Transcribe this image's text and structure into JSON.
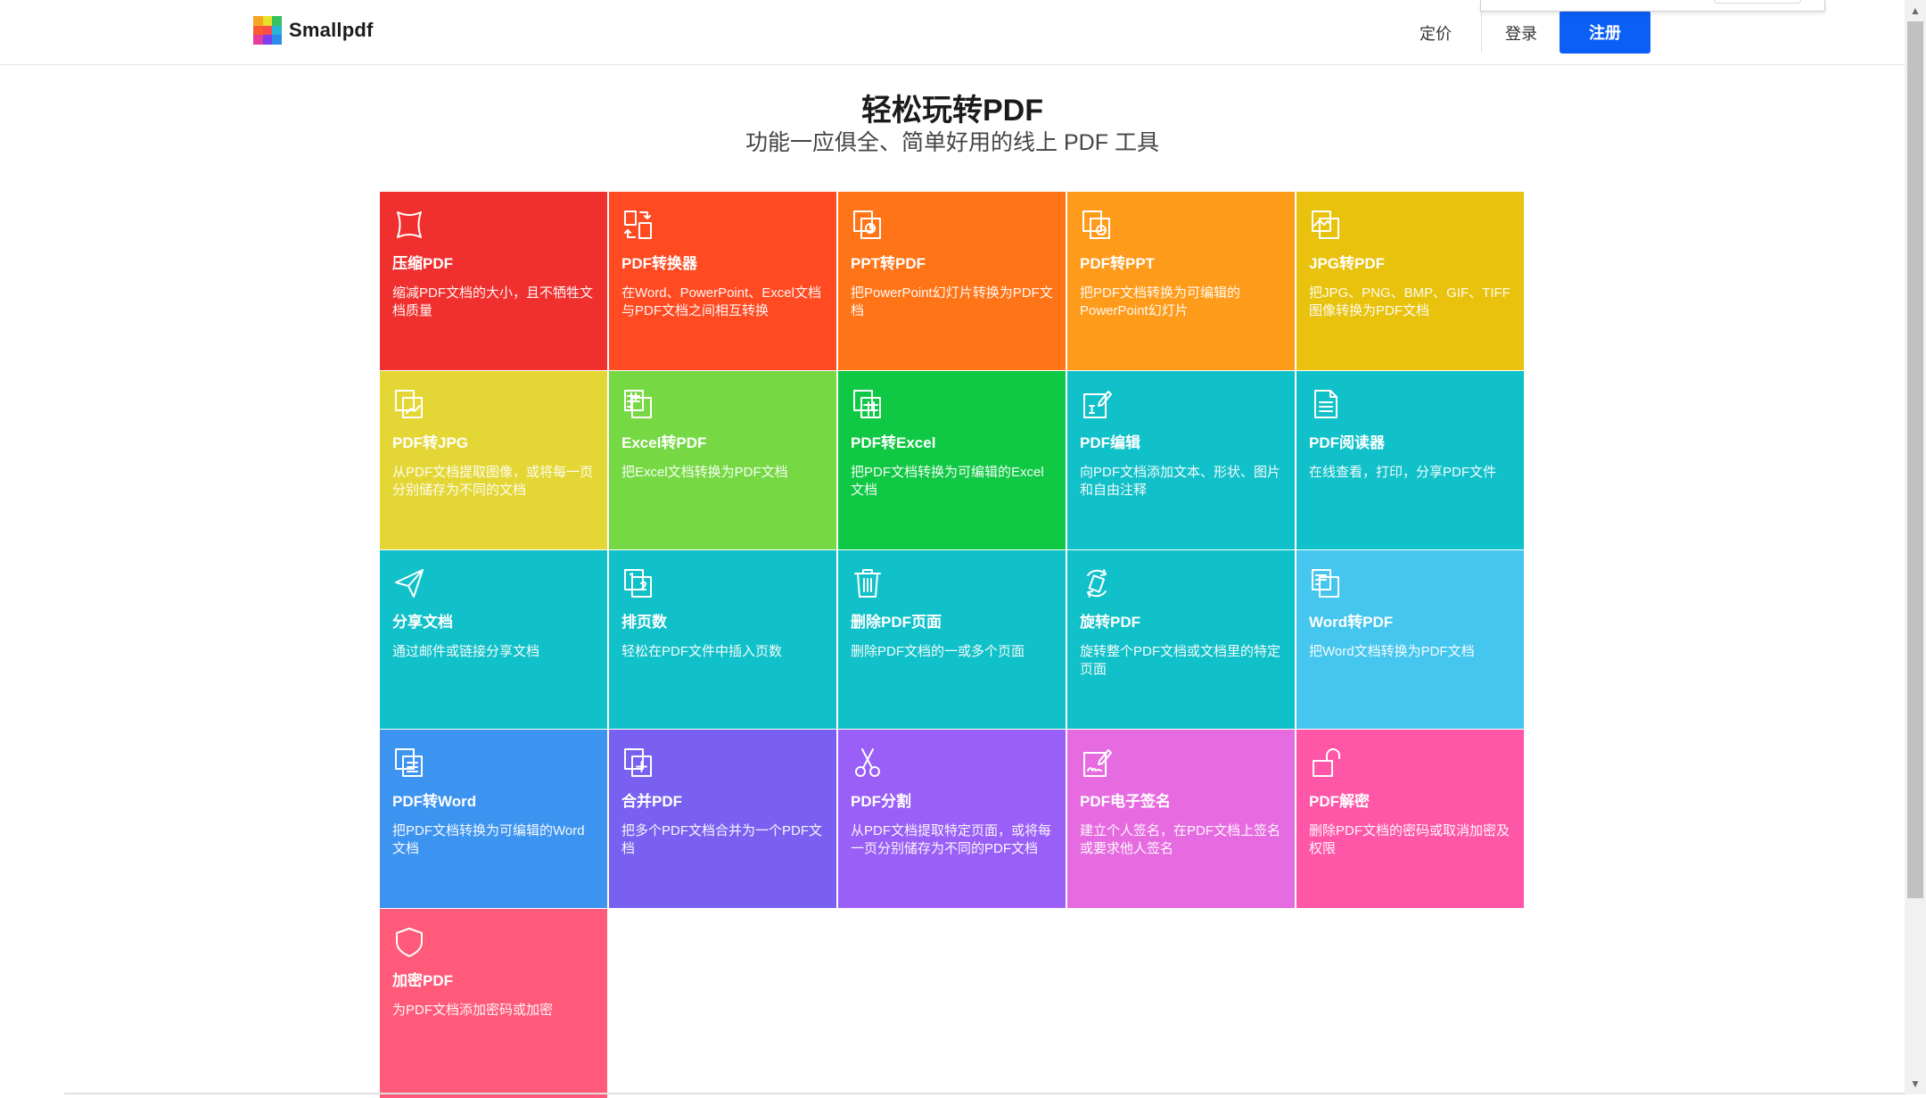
{
  "header": {
    "brand": "Smallpdf",
    "nav": {
      "pricing": "定价",
      "login": "登录",
      "signup": "注册"
    },
    "logo_colors": [
      "#f5a623",
      "#e8e12a",
      "#f75c2e",
      "#2d8be8",
      "#7c3ef0",
      "#e63c9c",
      "#37c15e",
      "#26b5d8",
      "#ff4a4a"
    ]
  },
  "hero": {
    "title": "轻松玩转PDF",
    "subtitle": "功能一应俱全、简单好用的线上 PDF 工具"
  },
  "tools": [
    {
      "icon": "compress-icon",
      "title": "压缩PDF",
      "desc": "缩减PDF文档的大小，且不牺牲文档质量",
      "color": "#f0302f"
    },
    {
      "icon": "convert-icon",
      "title": "PDF转换器",
      "desc": "在Word、PowerPoint、Excel文档与PDF文档之间相互转换",
      "color": "#ff4a22"
    },
    {
      "icon": "ppt-to-pdf-icon",
      "title": "PPT转PDF",
      "desc": "把PowerPoint幻灯片转换为PDF文档",
      "color": "#ff7417"
    },
    {
      "icon": "pdf-to-ppt-icon",
      "title": "PDF转PPT",
      "desc": "把PDF文档转换为可编辑的PowerPoint幻灯片",
      "color": "#ff9b1a"
    },
    {
      "icon": "jpg-to-pdf-icon",
      "title": "JPG转PDF",
      "desc": "把JPG、PNG、BMP、GIF、TIFF图像转换为PDF文档",
      "color": "#e8c20c"
    },
    {
      "icon": "pdf-to-jpg-icon",
      "title": "PDF转JPG",
      "desc": "从PDF文档提取图像，或将每一页分别储存为不同的文档",
      "color": "#e4d735"
    },
    {
      "icon": "excel-to-pdf-icon",
      "title": "Excel转PDF",
      "desc": "把Excel文档转换为PDF文档",
      "color": "#76d944"
    },
    {
      "icon": "pdf-to-excel-icon",
      "title": "PDF转Excel",
      "desc": "把PDF文档转换为可编辑的Excel文档",
      "color": "#0fc843"
    },
    {
      "icon": "edit-pdf-icon",
      "title": "PDF编辑",
      "desc": "向PDF文档添加文本、形状、图片和自由注释",
      "color": "#11c1c9"
    },
    {
      "icon": "reader-icon",
      "title": "PDF阅读器",
      "desc": "在线查看，打印，分享PDF文件",
      "color": "#11c1c9"
    },
    {
      "icon": "share-icon",
      "title": "分享文档",
      "desc": "通过邮件或链接分享文档",
      "color": "#11c1c9"
    },
    {
      "icon": "page-numbers-icon",
      "title": "排页数",
      "desc": "轻松在PDF文件中插入页数",
      "color": "#11c1c9"
    },
    {
      "icon": "trash-icon",
      "title": "删除PDF页面",
      "desc": "删除PDF文档的一或多个页面",
      "color": "#11c1c9"
    },
    {
      "icon": "rotate-icon",
      "title": "旋转PDF",
      "desc": "旋转整个PDF文档或文档里的特定页面",
      "color": "#11c1c9"
    },
    {
      "icon": "word-to-pdf-icon",
      "title": "Word转PDF",
      "desc": "把Word文档转换为PDF文档",
      "color": "#45c6ef"
    },
    {
      "icon": "pdf-to-word-icon",
      "title": "PDF转Word",
      "desc": "把PDF文档转换为可编辑的Word文档",
      "color": "#3d94f0"
    },
    {
      "icon": "merge-icon",
      "title": "合并PDF",
      "desc": "把多个PDF文档合并为一个PDF文档",
      "color": "#7a60f0"
    },
    {
      "icon": "scissors-icon",
      "title": "PDF分割",
      "desc": "从PDF文档提取特定页面，或将每一页分别储存为不同的PDF文档",
      "color": "#9a5ff6"
    },
    {
      "icon": "esign-icon",
      "title": "PDF电子签名",
      "desc": "建立个人签名，在PDF文档上签名或要求他人签名",
      "color": "#e66be0"
    },
    {
      "icon": "unlock-icon",
      "title": "PDF解密",
      "desc": "删除PDF文档的密码或取消加密及权限",
      "color": "#ff57a8"
    },
    {
      "icon": "shield-icon",
      "title": "加密PDF",
      "desc": "为PDF文档添加密码或加密",
      "color": "#ff5a79"
    }
  ]
}
